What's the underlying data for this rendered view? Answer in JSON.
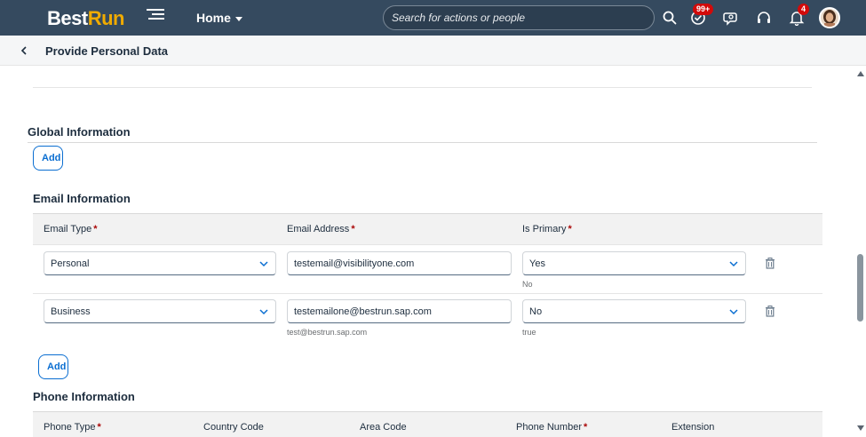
{
  "shell": {
    "logo_part1": "Best",
    "logo_part2": "Run",
    "home_label": "Home",
    "search_placeholder": "Search for actions or people",
    "tasks_badge": "99+",
    "notifications_badge": "4"
  },
  "subheader": {
    "title": "Provide Personal Data"
  },
  "global": {
    "title": "Global Information",
    "add_label": "Add"
  },
  "email": {
    "title": "Email Information",
    "columns": [
      {
        "label": "Email Type",
        "required": "*"
      },
      {
        "label": "Email Address",
        "required": "*"
      },
      {
        "label": "Is Primary",
        "required": "*"
      }
    ],
    "rows": [
      {
        "type": "Personal",
        "address": "testemail@visibilityone.com",
        "address_hint": "",
        "primary": "Yes",
        "primary_hint": "No"
      },
      {
        "type": "Business",
        "address": "testemailone@bestrun.sap.com",
        "address_hint": "test@bestrun.sap.com",
        "primary": "No",
        "primary_hint": "true"
      }
    ],
    "add_label": "Add"
  },
  "phone": {
    "title": "Phone Information",
    "columns": [
      {
        "label": "Phone Type",
        "required": "*"
      },
      {
        "label": "Country Code",
        "required": ""
      },
      {
        "label": "Area Code",
        "required": ""
      },
      {
        "label": "Phone Number",
        "required": "*"
      },
      {
        "label": "Extension",
        "required": ""
      }
    ]
  },
  "colors": {
    "shell": "#354a5f",
    "accent": "#0a6ed1",
    "required": "#aa0808",
    "badge": "#d20a0a",
    "logo_accent": "#f0ab00"
  }
}
